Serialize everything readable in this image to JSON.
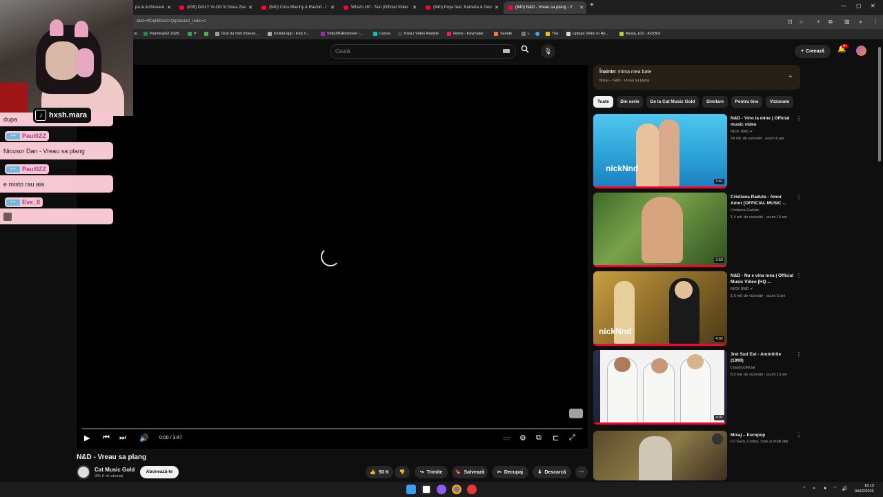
{
  "browser": {
    "tabs": [
      {
        "title": "pa la inchisoare"
      },
      {
        "title": "(839) DAILY VLOG în Noua Zee"
      },
      {
        "title": "(840) Criss Blaziny & Rashid - I"
      },
      {
        "title": "What's UP - Taxi (Official Video"
      },
      {
        "title": "(840) Puya feat. Kamelia & Geo"
      },
      {
        "title": "(840) N&D - Vreau sa plang - Y"
      }
    ],
    "url": "&list=RDqNEh2iCrQqA&start_radio=1",
    "bookmarks": [
      {
        "label": "re",
        "color": "#888888"
      },
      {
        "label": "PlanningG2 2026",
        "color": "#1e8e3e"
      },
      {
        "label": "P",
        "color": "#34a853"
      },
      {
        "label": "",
        "color": "#4caf50"
      },
      {
        "label": "Oral du chef d'oeuvr...",
        "color": "#9e9e9e"
      },
      {
        "label": "Kicklet.app - Kick C...",
        "color": "#aaaaaa"
      },
      {
        "label": "VideoBGRemover -...",
        "color": "#9c27b0"
      },
      {
        "label": "Canva",
        "color": "#00c4cc"
      },
      {
        "label": "Krea | Video Restyle",
        "color": "#222222"
      },
      {
        "label": "Home - Keymailer",
        "color": "#e91e63"
      },
      {
        "label": "Seriale",
        "color": "#ff7043"
      },
      {
        "label": "L",
        "color": "#777777"
      },
      {
        "label": "",
        "color": "#29b6f6"
      },
      {
        "label": "The",
        "color": "#fbbc04"
      },
      {
        "label": "Upload Video to Re...",
        "color": "#dddddd"
      },
      {
        "label": "Alysia_k12 - KickBot",
        "color": "#c0ca33"
      }
    ]
  },
  "header": {
    "search_placeholder": "Caută",
    "create_label": "Creează",
    "notif_badge": "9+"
  },
  "player": {
    "time": "0:00 / 3:47"
  },
  "video": {
    "title": "N&D - Vreau sa plang",
    "channel": "Cat Music Gold",
    "subscribers": "385 K de abonați",
    "subscribe_label": "Abonează-te",
    "likes": "50 K",
    "share_label": "Trimite",
    "save_label": "Salvează",
    "clip_label": "Decupaj",
    "download_label": "Descarcă"
  },
  "up_next": {
    "prefix": "Înainte:",
    "title": "Inima mea bate",
    "subtitle": "Mixaj – N&D - Vreau sa plang"
  },
  "chips": [
    "Toate",
    "Din serie",
    "De la Cat Music Gold",
    "Similare",
    "Pentru tine",
    "Vizionate"
  ],
  "recommendations": [
    {
      "title": "N&D - Vino la mine | Official music video",
      "channel": "NICK NND",
      "meta": "24 mil. de vizionări · acum 6 ani",
      "duration": "3:41"
    },
    {
      "title": "Cristiana Raduta - Amor Amor [OFFICIAL MUSIC ...",
      "channel": "Cristiana Raduta",
      "meta": "1,4 mil. de vizionări · acum 14 ani",
      "duration": "3:53"
    },
    {
      "title": "N&D - Nu e vina mea | Official Music Video [HQ ...",
      "channel": "NICK NND",
      "meta": "1,6 mil. de vizionări · acum 5 ani",
      "duration": "4:02"
    },
    {
      "title": "3rei Sud Est - Amintirile (1999)",
      "channel": "ClaudiuOfficial",
      "meta": "8,5 mil. de vizionări · acum 13 ani",
      "duration": "4:01"
    },
    {
      "title": "Mixaj – Europop",
      "channel": "DJ Sava, Corina, Sore și mulți alții",
      "meta": "",
      "duration": ""
    }
  ],
  "overlay": {
    "streamer": "hxsh.mara",
    "chat": [
      {
        "type": "msg",
        "text": "dupa"
      },
      {
        "type": "user",
        "name": "Paul0ZZ"
      },
      {
        "type": "msg",
        "text": "Nicusor Dan - Vreau sa plang"
      },
      {
        "type": "user",
        "name": "Paul0ZZ"
      },
      {
        "type": "msg",
        "text": "e misto rau aia"
      },
      {
        "type": "user",
        "name": "Eve_8"
      },
      {
        "type": "msg",
        "text": ""
      }
    ]
  },
  "taskbar": {
    "time": "18:13",
    "date": "04/02/2026"
  }
}
